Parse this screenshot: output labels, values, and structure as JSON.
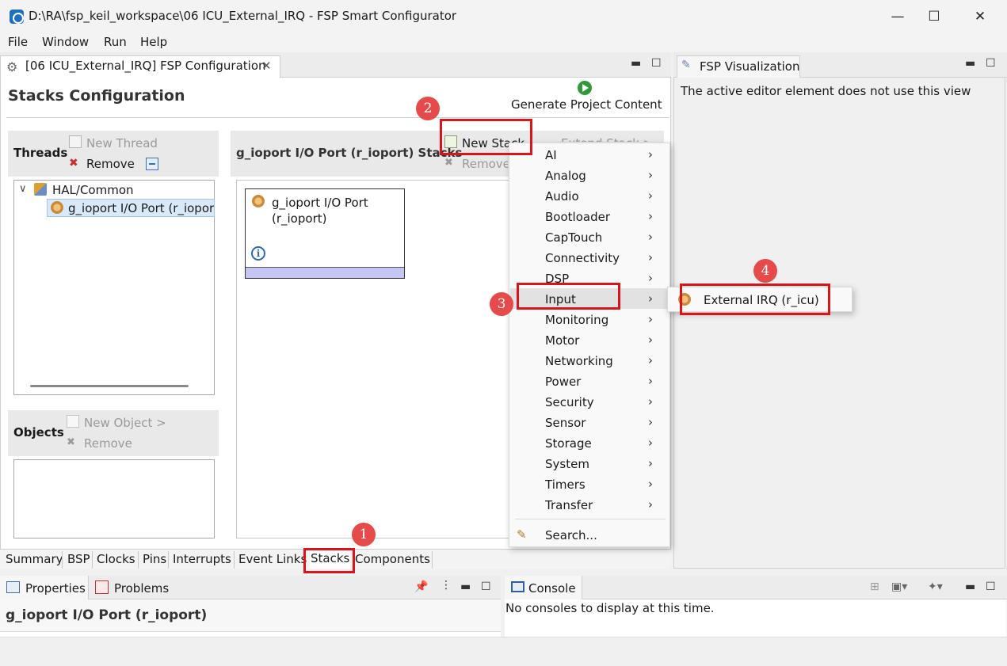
{
  "window": {
    "title": "D:\\RA\\fsp_keil_workspace\\06 ICU_External_IRQ - FSP Smart Configurator",
    "minimize": "—",
    "maximize": "☐",
    "close": "✕"
  },
  "menubar": [
    "File",
    "Window",
    "Run",
    "Help"
  ],
  "editor": {
    "tab_label": "[06 ICU_External_IRQ] FSP Configuration",
    "title": "Stacks Configuration",
    "generate_label": "Generate Project Content"
  },
  "threads": {
    "label": "Threads",
    "new_thread": "New Thread",
    "remove": "Remove",
    "tree_root": "HAL/Common",
    "tree_child": "g_ioport I/O Port (r_ioport)"
  },
  "objects": {
    "label": "Objects",
    "new_object": "New Object >",
    "remove": "Remove"
  },
  "stacks": {
    "header": "g_ioport I/O Port (r_ioport) Stacks",
    "new_stack": "New Stack >",
    "extend_stack": "Extend Stack >",
    "remove": "Remove",
    "card_line1": "g_ioport I/O Port",
    "card_line2": "(r_ioport)"
  },
  "context_menu": {
    "items": [
      "AI",
      "Analog",
      "Audio",
      "Bootloader",
      "CapTouch",
      "Connectivity",
      "DSP",
      "Input",
      "Monitoring",
      "Motor",
      "Networking",
      "Power",
      "Security",
      "Sensor",
      "Storage",
      "System",
      "Timers",
      "Transfer"
    ],
    "search": "Search...",
    "submenu_item": "External IRQ (r_icu)"
  },
  "bottom_tabs": [
    "Summary",
    "BSP",
    "Clocks",
    "Pins",
    "Interrupts",
    "Event Links",
    "Stacks",
    "Components"
  ],
  "visualization": {
    "tab": "FSP Visualization",
    "message": "The active editor element does not use this view"
  },
  "properties": {
    "tab1": "Properties",
    "tab2": "Problems",
    "selection": "g_ioport I/O Port (r_ioport)"
  },
  "console": {
    "tab": "Console",
    "message": "No consoles to display at this time."
  },
  "annotations": [
    "1",
    "2",
    "3",
    "4"
  ],
  "colors": {
    "highlight_red": "#d9151b",
    "badge_red": "#e64a4a",
    "stack_bar": "#c6c6f5",
    "selection": "#d9e9f8"
  }
}
